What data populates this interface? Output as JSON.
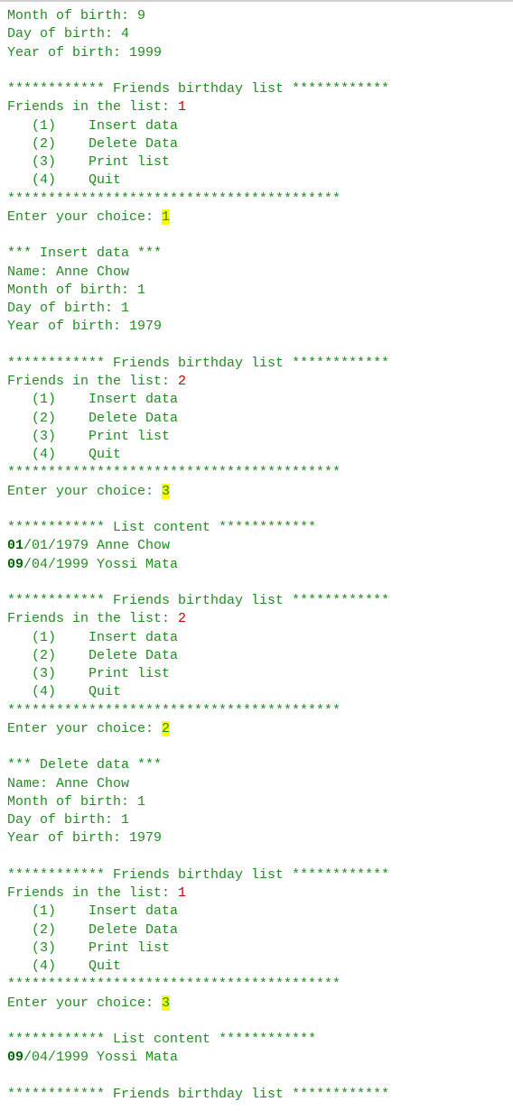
{
  "intro": {
    "month": "Month of birth: 9",
    "day": "Day of birth: 4",
    "year": "Year of birth: 1999"
  },
  "stars12": "************",
  "banner_title": " Friends birthday list ",
  "friends_label": "Friends in the list: ",
  "menu_border": "*****************************************",
  "menu": {
    "opt1": "   (1)    Insert data",
    "opt2": "   (2)    Delete Data",
    "opt3": "   (3)    Print list",
    "opt4": "   (4)    Quit"
  },
  "enter_choice": "Enter your choice: ",
  "list_content_title": " List content ",
  "insert_header": "*** Insert data ***",
  "delete_header": "*** Delete data ***",
  "block1": {
    "count": "1",
    "choice": "1"
  },
  "insert1": {
    "name": "Name: Anne Chow",
    "month": "Month of birth: 1",
    "day": "Day of birth: 1",
    "year": "Year of birth: 1979"
  },
  "block2": {
    "count": "2",
    "choice": "3"
  },
  "list1": {
    "r1_bold": "01",
    "r1_rest": "/01/1979 Anne Chow",
    "r2_bold": "09",
    "r2_rest": "/04/1999 Yossi Mata"
  },
  "block3": {
    "count": "2",
    "choice": "2"
  },
  "delete1": {
    "name": "Name: Anne Chow",
    "month": "Month of birth: 1",
    "day": "Day of birth: 1",
    "year": "Year of birth: 1979"
  },
  "block4": {
    "count": "1",
    "choice": "3"
  },
  "list2": {
    "r1_bold": "09",
    "r1_rest": "/04/1999 Yossi Mata"
  }
}
